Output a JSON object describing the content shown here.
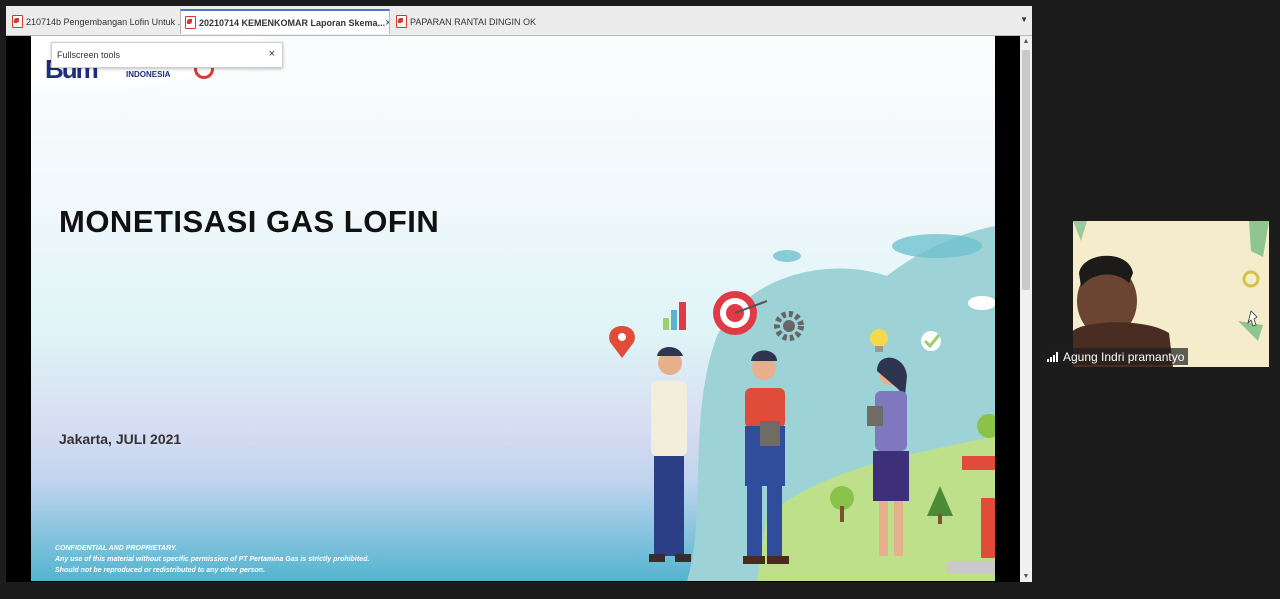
{
  "tabs": [
    {
      "label": "210714b Pengembangan Lofin Untuk ...",
      "active": false
    },
    {
      "label": "20210714 KEMENKOMAR Laporan Skema...",
      "active": true
    },
    {
      "label": "PAPARAN RANTAI DINGIN OK",
      "active": false
    }
  ],
  "tab_close_glyph": "×",
  "tab_dropdown_glyph": "▼",
  "fullscreen_tools": {
    "label": "Fullscreen tools",
    "close_glyph": "×"
  },
  "slide": {
    "logo_mark": "Bum",
    "logo_text": "INDONESIA",
    "title": "MONETISASI GAS LOFIN",
    "place_date": "Jakarta, JULI 2021",
    "footer_lines": [
      "CONFIDENTIAL AND PROPRIETARY.",
      "Any use of this material without specific permission of PT Pertamina Gas is strictly prohibited.",
      "Should not be reproduced or redistributed to any other person."
    ]
  },
  "scrollbar": {
    "up_glyph": "▲",
    "down_glyph": "▼"
  },
  "video": {
    "participant_name": "Agung Indri pramantyo"
  },
  "colors": {
    "tab_active_accent": "#4a78c8",
    "pdf_icon": "#d23a2b",
    "brand_blue": "#1d2f7a",
    "brand_red": "#d83a3a",
    "target_red": "#e03a46"
  },
  "icons": [
    "pdf-icon",
    "close-icon",
    "dropdown-icon",
    "signal-icon",
    "map-pin-icon",
    "target-icon",
    "gear-icon",
    "lightbulb-icon",
    "checkmark-icon",
    "bar-chart-icon"
  ]
}
